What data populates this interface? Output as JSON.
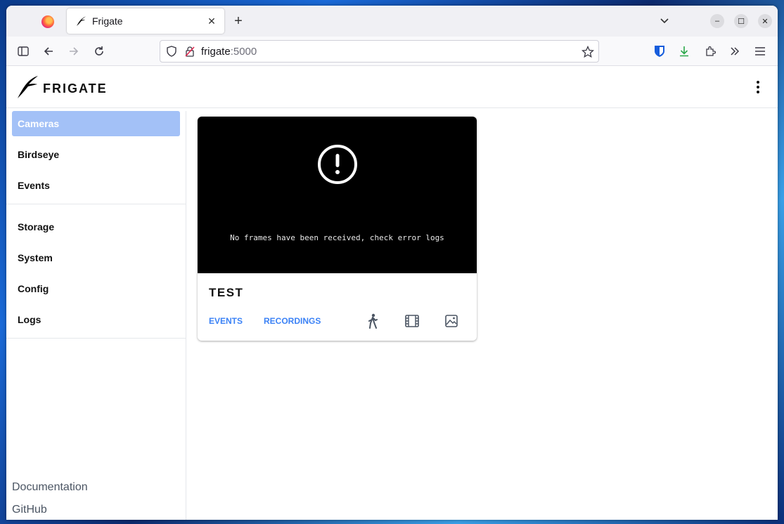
{
  "browser": {
    "tab_title": "Frigate",
    "url_host": "frigate",
    "url_port": ":5000"
  },
  "app": {
    "brand": "FRIGATE"
  },
  "sidebar": {
    "items": [
      {
        "label": "Cameras"
      },
      {
        "label": "Birdseye"
      },
      {
        "label": "Events"
      },
      {
        "label": "Storage"
      },
      {
        "label": "System"
      },
      {
        "label": "Config"
      },
      {
        "label": "Logs"
      }
    ],
    "footer": {
      "documentation": "Documentation",
      "github": "GitHub"
    }
  },
  "camera": {
    "name": "TEST",
    "error_message": "No frames have been received, check error logs",
    "links": {
      "events": "EVENTS",
      "recordings": "RECORDINGS"
    }
  },
  "colors": {
    "active_nav": "#a3c1f7",
    "link": "#3b82f6"
  }
}
